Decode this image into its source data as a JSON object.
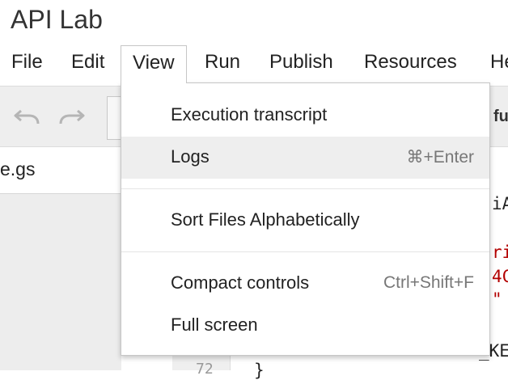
{
  "app": {
    "title": "API Lab"
  },
  "menubar": {
    "items": [
      {
        "label": "File"
      },
      {
        "label": "Edit"
      },
      {
        "label": "View"
      },
      {
        "label": "Run"
      },
      {
        "label": "Publish"
      },
      {
        "label": "Resources"
      },
      {
        "label": "He"
      }
    ]
  },
  "toolbar": {
    "undo_icon": "undo-icon",
    "redo_icon": "redo-icon",
    "function_select_partial": "fu"
  },
  "files": {
    "items": [
      {
        "name": "e.gs"
      }
    ]
  },
  "view_menu": {
    "items": [
      {
        "label": "Execution transcript",
        "shortcut": ""
      },
      {
        "label": "Logs",
        "shortcut": "⌘+Enter"
      },
      {
        "label": "Sort Files Alphabetically",
        "shortcut": ""
      },
      {
        "label": "Compact controls",
        "shortcut": "Ctrl+Shift+F"
      },
      {
        "label": "Full screen",
        "shortcut": ""
      }
    ]
  },
  "editor": {
    "code_fragments": [
      "iA",
      "ri",
      "4C",
      "\"",
      "_KE",
      "}"
    ],
    "line_number": "72"
  },
  "colors": {
    "highlight": "#eeeeee",
    "code_string": "#b30000"
  }
}
